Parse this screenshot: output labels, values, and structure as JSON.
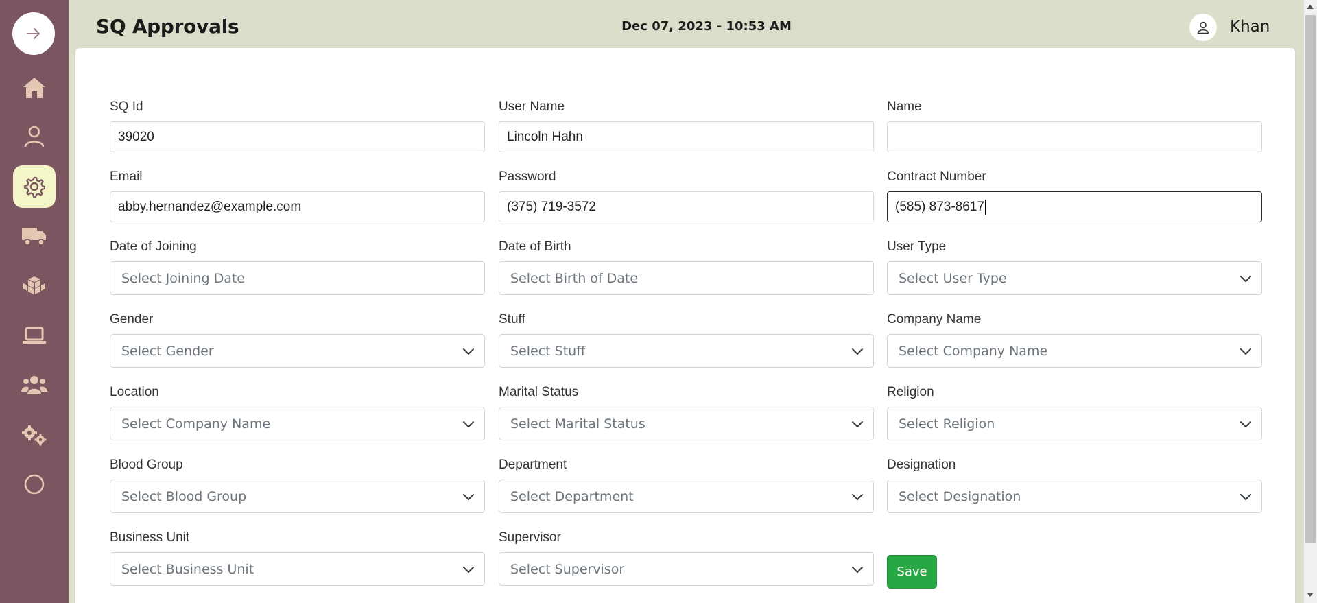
{
  "header": {
    "title": "SQ Approvals",
    "datetime": "Dec 07, 2023 - 10:53 AM",
    "user_name": "Khan"
  },
  "sidebar": {
    "items": [
      {
        "icon": "home-icon",
        "active": false
      },
      {
        "icon": "user-icon",
        "active": false
      },
      {
        "icon": "gear-icon",
        "active": true
      },
      {
        "icon": "truck-icon",
        "active": false
      },
      {
        "icon": "boxes-icon",
        "active": false
      },
      {
        "icon": "laptop-icon",
        "active": false
      },
      {
        "icon": "users-icon",
        "active": false
      },
      {
        "icon": "cogs-icon",
        "active": false
      },
      {
        "icon": "circle-icon",
        "active": false
      }
    ]
  },
  "form": {
    "sq_id": {
      "label": "SQ Id",
      "value": "39020"
    },
    "user_name": {
      "label": "User Name",
      "value": "Lincoln Hahn"
    },
    "name": {
      "label": "Name",
      "value": ""
    },
    "email": {
      "label": "Email",
      "value": "abby.hernandez@example.com"
    },
    "password": {
      "label": "Password",
      "value": "(375) 719-3572"
    },
    "contract_number": {
      "label": "Contract Number",
      "value": "(585) 873-8617"
    },
    "date_of_joining": {
      "label": "Date of Joining",
      "placeholder": "Select Joining Date"
    },
    "date_of_birth": {
      "label": "Date of Birth",
      "placeholder": "Select Birth of Date"
    },
    "user_type": {
      "label": "User Type",
      "placeholder": "Select User Type"
    },
    "gender": {
      "label": "Gender",
      "placeholder": "Select Gender"
    },
    "stuff": {
      "label": "Stuff",
      "placeholder": "Select Stuff"
    },
    "company_name": {
      "label": "Company Name",
      "placeholder": "Select Company Name"
    },
    "location": {
      "label": "Location",
      "placeholder": "Select Company Name"
    },
    "marital_status": {
      "label": "Marital Status",
      "placeholder": "Select Marital Status"
    },
    "religion": {
      "label": "Religion",
      "placeholder": "Select Religion"
    },
    "blood_group": {
      "label": "Blood Group",
      "placeholder": "Select Blood Group"
    },
    "department": {
      "label": "Department",
      "placeholder": "Select Department"
    },
    "designation": {
      "label": "Designation",
      "placeholder": "Select Designation"
    },
    "business_unit": {
      "label": "Business Unit",
      "placeholder": "Select Business Unit"
    },
    "supervisor": {
      "label": "Supervisor",
      "placeholder": "Select Supervisor"
    },
    "save_label": "Save"
  },
  "colors": {
    "sidebar_bg": "#7b5660",
    "header_bg": "#dcdecb",
    "active_item_bg": "#f4f6c8",
    "icon_color": "#e3c7b3",
    "save_bg": "#28a745"
  }
}
